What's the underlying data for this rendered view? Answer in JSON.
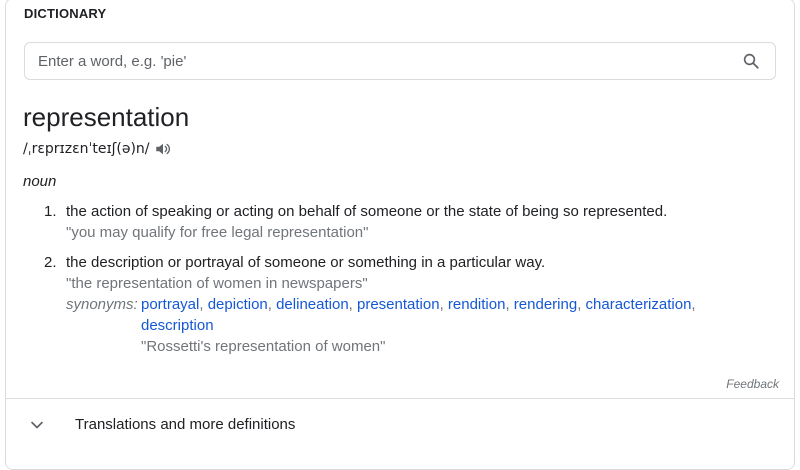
{
  "header": {
    "label": "DICTIONARY"
  },
  "search": {
    "placeholder": "Enter a word, e.g. 'pie'",
    "value": ""
  },
  "entry": {
    "headword": "representation",
    "pronunciation": "/ˌrɛprɪzɛnˈteɪʃ(ə)n/",
    "part_of_speech": "noun",
    "definitions": [
      {
        "number": "1.",
        "text": "the action of speaking or acting on behalf of someone or the state of being so represented.",
        "example": "\"you may qualify for free legal representation\""
      },
      {
        "number": "2.",
        "text": "the description or portrayal of someone or something in a particular way.",
        "example": "\"the representation of women in newspapers\"",
        "synonyms_label": "synonyms:",
        "synonyms": [
          "portrayal",
          "depiction",
          "delineation",
          "presentation",
          "rendition",
          "rendering",
          "characterization",
          "description"
        ],
        "synonym_example": "\"Rossetti's representation of women\""
      }
    ]
  },
  "feedback_label": "Feedback",
  "more": {
    "label": "Translations and more definitions"
  },
  "icons": {
    "search": "search-icon",
    "speaker": "speaker-icon",
    "chevron": "chevron-down-icon"
  },
  "colors": {
    "link": "#1558d6",
    "muted": "#70757a",
    "border": "#dadce0"
  }
}
